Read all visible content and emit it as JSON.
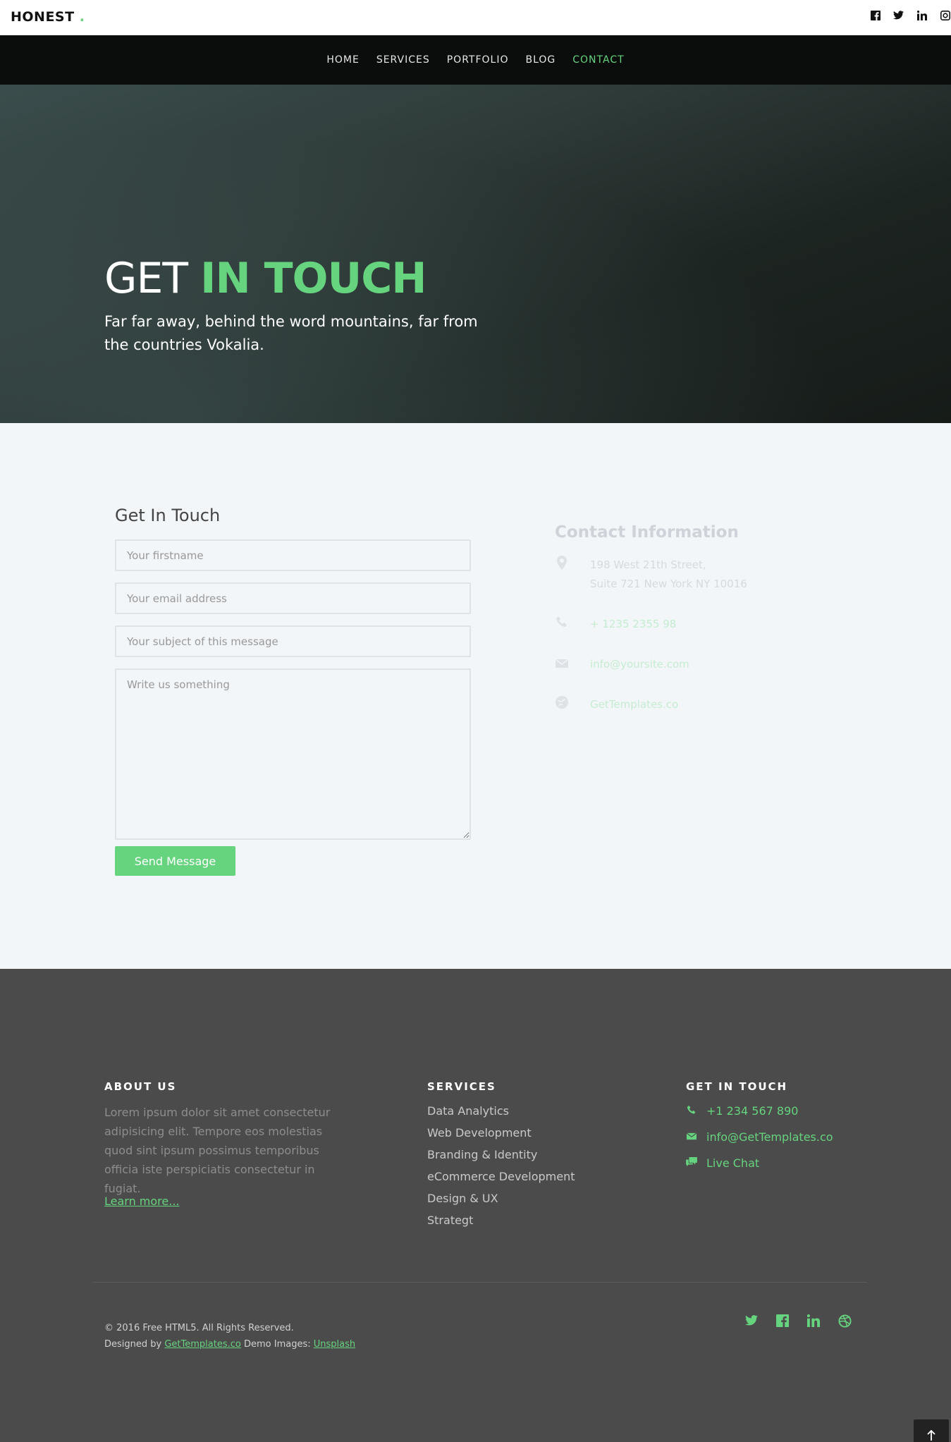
{
  "brand": {
    "name": "HONEST",
    "dot": "."
  },
  "top_social": [
    "facebook-icon",
    "twitter-icon",
    "linkedin-icon",
    "instagram-icon"
  ],
  "nav": {
    "items": [
      {
        "label": "HOME",
        "active": false
      },
      {
        "label": "SERVICES",
        "active": false
      },
      {
        "label": "PORTFOLIO",
        "active": false
      },
      {
        "label": "BLOG",
        "active": false
      },
      {
        "label": "CONTACT",
        "active": true
      }
    ]
  },
  "hero": {
    "title_plain": "GET",
    "title_highlight": "IN TOUCH",
    "subtitle": "Far far away, behind the word mountains, far from the countries Vokalia."
  },
  "form": {
    "title": "Get In Touch",
    "firstname_placeholder": "Your firstname",
    "email_placeholder": "Your email address",
    "subject_placeholder": "Your subject of this message",
    "message_placeholder": "Write us something",
    "send_label": "Send Message"
  },
  "info": {
    "title": "Contact Information",
    "address_line1": "198 West 21th Street,",
    "address_line2": "Suite 721 New York NY 10016",
    "phone": "+ 1235 2355 98",
    "email": "info@yoursite.com",
    "website": "GetTemplates.co"
  },
  "footer": {
    "about_heading": "ABOUT US",
    "about_text": "Lorem ipsum dolor sit amet consectetur adipisicing elit. Tempore eos molestias quod sint ipsum possimus temporibus officia iste perspiciatis consectetur in fugiat.",
    "learn_more": "Learn more...",
    "services_heading": "SERVICES",
    "services": [
      "Data Analytics",
      "Web Development",
      "Branding & Identity",
      "eCommerce Development",
      "Design & UX",
      "Strategt"
    ],
    "git_heading": "GET IN TOUCH",
    "git_phone": "+1 234 567 890",
    "git_email": "info@GetTemplates.co",
    "git_chat": "Live Chat",
    "copyright": "© 2016 Free HTML5. All Rights Reserved.",
    "designed_by_prefix": "Designed by",
    "designed_by_link": "GetTemplates.co",
    "demo_images_prefix": "Demo Images:",
    "demo_images_link": "Unsplash",
    "social": [
      "twitter-icon",
      "facebook-icon",
      "linkedin-icon",
      "dribbble-icon"
    ]
  },
  "colors": {
    "accent": "#66d37e",
    "footer_bg": "#4b4b4b",
    "contact_bg": "#f2f6f9",
    "nav_bg": "#0b0d0c"
  }
}
